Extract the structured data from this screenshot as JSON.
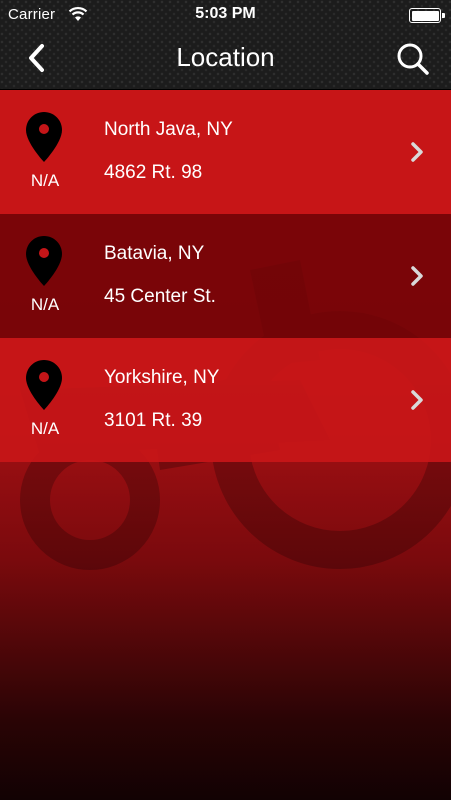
{
  "status_bar": {
    "carrier": "Carrier",
    "time": "5:03 PM",
    "wifi_icon": "wifi-icon",
    "battery_icon": "battery-icon"
  },
  "nav": {
    "title": "Location",
    "back_icon": "chevron-left-icon",
    "search_icon": "search-icon"
  },
  "locations": [
    {
      "distance": "N/A",
      "city": "North Java, NY",
      "street": "4862 Rt. 98"
    },
    {
      "distance": "N/A",
      "city": "Batavia, NY",
      "street": "45 Center St."
    },
    {
      "distance": "N/A",
      "city": "Yorkshire, NY",
      "street": "3101 Rt. 39"
    }
  ],
  "colors": {
    "row_primary": "#c81618",
    "row_alternate": "#6e0406",
    "header": "#1c1c1c",
    "pin": "#000000",
    "pin_dot": "#c41518",
    "chevron": "#d9d9d9"
  }
}
